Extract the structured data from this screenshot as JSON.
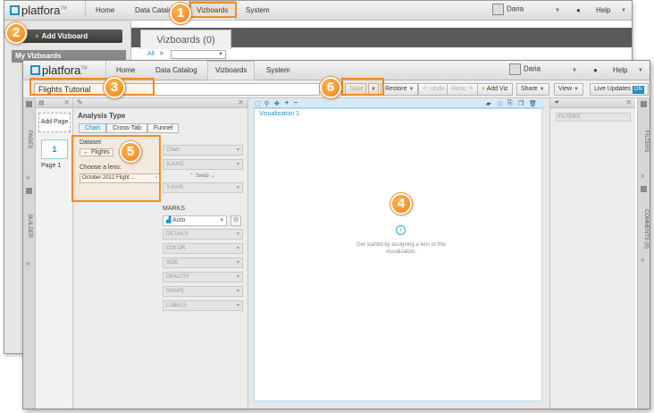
{
  "back_window": {
    "logo": "platfora",
    "logo_tm": "TM",
    "nav": [
      "Home",
      "Data Catalog",
      "Vizboards",
      "System"
    ],
    "user": "Daria",
    "help": "Help",
    "add_vizboard": "Add Vizboard",
    "my_vizboards": "My Vizboards",
    "vizboards_tab": "Vizboards (0)",
    "filter_all": "All",
    "filter_sep": ">"
  },
  "front_window": {
    "logo": "platfora",
    "logo_tm": "TM",
    "nav": [
      "Home",
      "Data Catalog",
      "Vizboards",
      "System"
    ],
    "user": "Daria",
    "help": "Help",
    "title_value": "Flights Tutorial",
    "toolbar": {
      "save": "Save",
      "restore": "Restore",
      "undo": "Undo",
      "redo": "Redo",
      "add_viz": "Add Viz",
      "share": "Share",
      "view": "View",
      "live_updates": "Live Updates",
      "live_state": "ON"
    },
    "pages_rail": "PAGES",
    "builder_rail": "BUILDER",
    "add_page": "Add Page",
    "page_number": "1",
    "page_label": "Page 1",
    "builder": {
      "analysis_type": "Analysis Type",
      "tabs": [
        "Chart",
        "Cross-Tab",
        "Funnel"
      ],
      "dataset_label": "Dataset",
      "dataset_value": "Flights",
      "lens_label": "Choose a lens:",
      "lens_value": "October 2012 Flight ...",
      "chart_field": "Chart",
      "x_axis": "X-AXIS",
      "swap": "Swap",
      "y_axis": "Y-AXIS",
      "marks": "MARKS",
      "auto": "Auto",
      "details": "DETAILS",
      "color": "COLOR",
      "size": "SIZE",
      "opacity": "OPACITY",
      "shape": "SHAPE",
      "labels": "LABELS"
    },
    "viz": {
      "title": "Visualization 1",
      "hint": "Get started by assigning a lens to this visualization."
    },
    "filters_title": "FILTERS",
    "filters_rail": "FILTERS",
    "comments_rail": "COMMENTS (0)"
  },
  "callouts": [
    "1",
    "2",
    "3",
    "4",
    "5",
    "6"
  ],
  "colors": {
    "accent": "#1f8fc5",
    "callout": "#f08c27",
    "plus": "#f39a1e"
  }
}
